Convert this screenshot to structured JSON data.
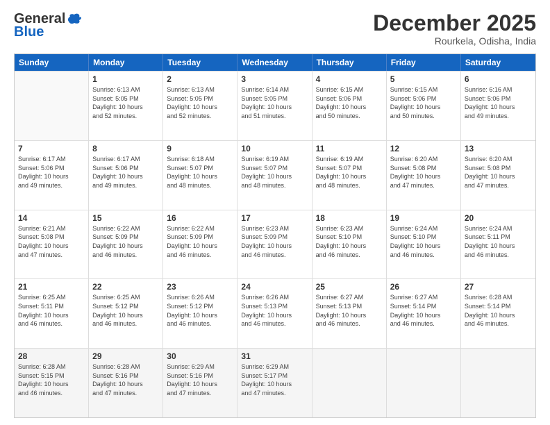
{
  "header": {
    "logo_line1": "General",
    "logo_line2": "Blue",
    "month": "December 2025",
    "location": "Rourkela, Odisha, India"
  },
  "days_of_week": [
    "Sunday",
    "Monday",
    "Tuesday",
    "Wednesday",
    "Thursday",
    "Friday",
    "Saturday"
  ],
  "weeks": [
    [
      {
        "day": "",
        "info": ""
      },
      {
        "day": "1",
        "info": "Sunrise: 6:13 AM\nSunset: 5:05 PM\nDaylight: 10 hours\nand 52 minutes."
      },
      {
        "day": "2",
        "info": "Sunrise: 6:13 AM\nSunset: 5:05 PM\nDaylight: 10 hours\nand 52 minutes."
      },
      {
        "day": "3",
        "info": "Sunrise: 6:14 AM\nSunset: 5:05 PM\nDaylight: 10 hours\nand 51 minutes."
      },
      {
        "day": "4",
        "info": "Sunrise: 6:15 AM\nSunset: 5:06 PM\nDaylight: 10 hours\nand 50 minutes."
      },
      {
        "day": "5",
        "info": "Sunrise: 6:15 AM\nSunset: 5:06 PM\nDaylight: 10 hours\nand 50 minutes."
      },
      {
        "day": "6",
        "info": "Sunrise: 6:16 AM\nSunset: 5:06 PM\nDaylight: 10 hours\nand 49 minutes."
      }
    ],
    [
      {
        "day": "7",
        "info": "Sunrise: 6:17 AM\nSunset: 5:06 PM\nDaylight: 10 hours\nand 49 minutes."
      },
      {
        "day": "8",
        "info": "Sunrise: 6:17 AM\nSunset: 5:06 PM\nDaylight: 10 hours\nand 49 minutes."
      },
      {
        "day": "9",
        "info": "Sunrise: 6:18 AM\nSunset: 5:07 PM\nDaylight: 10 hours\nand 48 minutes."
      },
      {
        "day": "10",
        "info": "Sunrise: 6:19 AM\nSunset: 5:07 PM\nDaylight: 10 hours\nand 48 minutes."
      },
      {
        "day": "11",
        "info": "Sunrise: 6:19 AM\nSunset: 5:07 PM\nDaylight: 10 hours\nand 48 minutes."
      },
      {
        "day": "12",
        "info": "Sunrise: 6:20 AM\nSunset: 5:08 PM\nDaylight: 10 hours\nand 47 minutes."
      },
      {
        "day": "13",
        "info": "Sunrise: 6:20 AM\nSunset: 5:08 PM\nDaylight: 10 hours\nand 47 minutes."
      }
    ],
    [
      {
        "day": "14",
        "info": "Sunrise: 6:21 AM\nSunset: 5:08 PM\nDaylight: 10 hours\nand 47 minutes."
      },
      {
        "day": "15",
        "info": "Sunrise: 6:22 AM\nSunset: 5:09 PM\nDaylight: 10 hours\nand 46 minutes."
      },
      {
        "day": "16",
        "info": "Sunrise: 6:22 AM\nSunset: 5:09 PM\nDaylight: 10 hours\nand 46 minutes."
      },
      {
        "day": "17",
        "info": "Sunrise: 6:23 AM\nSunset: 5:09 PM\nDaylight: 10 hours\nand 46 minutes."
      },
      {
        "day": "18",
        "info": "Sunrise: 6:23 AM\nSunset: 5:10 PM\nDaylight: 10 hours\nand 46 minutes."
      },
      {
        "day": "19",
        "info": "Sunrise: 6:24 AM\nSunset: 5:10 PM\nDaylight: 10 hours\nand 46 minutes."
      },
      {
        "day": "20",
        "info": "Sunrise: 6:24 AM\nSunset: 5:11 PM\nDaylight: 10 hours\nand 46 minutes."
      }
    ],
    [
      {
        "day": "21",
        "info": "Sunrise: 6:25 AM\nSunset: 5:11 PM\nDaylight: 10 hours\nand 46 minutes."
      },
      {
        "day": "22",
        "info": "Sunrise: 6:25 AM\nSunset: 5:12 PM\nDaylight: 10 hours\nand 46 minutes."
      },
      {
        "day": "23",
        "info": "Sunrise: 6:26 AM\nSunset: 5:12 PM\nDaylight: 10 hours\nand 46 minutes."
      },
      {
        "day": "24",
        "info": "Sunrise: 6:26 AM\nSunset: 5:13 PM\nDaylight: 10 hours\nand 46 minutes."
      },
      {
        "day": "25",
        "info": "Sunrise: 6:27 AM\nSunset: 5:13 PM\nDaylight: 10 hours\nand 46 minutes."
      },
      {
        "day": "26",
        "info": "Sunrise: 6:27 AM\nSunset: 5:14 PM\nDaylight: 10 hours\nand 46 minutes."
      },
      {
        "day": "27",
        "info": "Sunrise: 6:28 AM\nSunset: 5:14 PM\nDaylight: 10 hours\nand 46 minutes."
      }
    ],
    [
      {
        "day": "28",
        "info": "Sunrise: 6:28 AM\nSunset: 5:15 PM\nDaylight: 10 hours\nand 46 minutes."
      },
      {
        "day": "29",
        "info": "Sunrise: 6:28 AM\nSunset: 5:16 PM\nDaylight: 10 hours\nand 47 minutes."
      },
      {
        "day": "30",
        "info": "Sunrise: 6:29 AM\nSunset: 5:16 PM\nDaylight: 10 hours\nand 47 minutes."
      },
      {
        "day": "31",
        "info": "Sunrise: 6:29 AM\nSunset: 5:17 PM\nDaylight: 10 hours\nand 47 minutes."
      },
      {
        "day": "",
        "info": ""
      },
      {
        "day": "",
        "info": ""
      },
      {
        "day": "",
        "info": ""
      }
    ]
  ]
}
